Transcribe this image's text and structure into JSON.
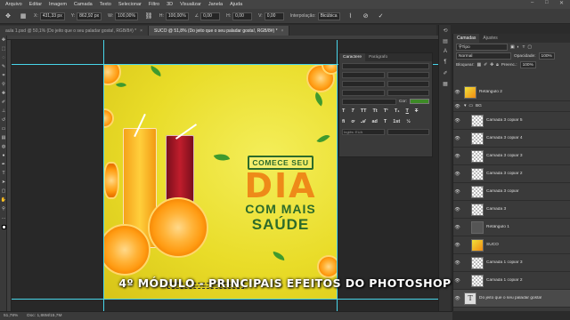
{
  "menu": [
    "Arquivo",
    "Editar",
    "Imagem",
    "Camada",
    "Texto",
    "Selecionar",
    "Filtro",
    "3D",
    "Visualizar",
    "Janela",
    "Ajuda"
  ],
  "window_controls": {
    "minimize": "–",
    "maximize": "□",
    "close": "✕"
  },
  "options": {
    "x": "431,33 px",
    "y": "862,92 px",
    "w": "100,00%",
    "h": "100,00%",
    "angle": "0,00",
    "h_skew": "0,00",
    "v_skew": "0,00",
    "interpolation_label": "Interpolação:",
    "interpolation_value": "Bicúbica"
  },
  "tabs": [
    {
      "label": "aula 1.psd @ 50,1% (Do jeito que o seu paladar gosta!, RGB/8#) *",
      "active": false
    },
    {
      "label": "SUCO @ 51,8% (Do jeito que o seu paladar gosta!, RGB/8#) *",
      "active": true
    }
  ],
  "canvas": {
    "banner": "COMECE SEU",
    "big": "DIA",
    "line2": "COM MAIS",
    "line3": "SAÚDE",
    "selection_text": "Do jeito que o seu paladar gosta!"
  },
  "char_panel": {
    "tabs": [
      "Caractere",
      "Parágrafo"
    ],
    "color_label": "Cor:",
    "language": "Inglês: EUA"
  },
  "layers_panel": {
    "tabs": [
      "Camadas",
      "Ajustes"
    ],
    "filter_kind": "Tipo",
    "blend_mode": "Normal",
    "opacity_label": "Opacidade:",
    "opacity_value": "100%",
    "lock_label": "Bloquear:",
    "fill_label": "Preenc.:",
    "fill_value": "100%",
    "layers": [
      {
        "name": "Retângulo 2",
        "kind": "img"
      },
      {
        "name": "BG",
        "kind": "group"
      },
      {
        "name": "Camada 3 copiar 5",
        "kind": "trans"
      },
      {
        "name": "Camada 3 copiar 4",
        "kind": "trans"
      },
      {
        "name": "Camada 3 copiar 3",
        "kind": "trans"
      },
      {
        "name": "Camada 3 copiar 2",
        "kind": "trans"
      },
      {
        "name": "Camada 3 copiar",
        "kind": "trans"
      },
      {
        "name": "Camada 3",
        "kind": "trans"
      },
      {
        "name": "Retângulo 1",
        "kind": "trans"
      },
      {
        "name": "SUCO",
        "kind": "img"
      },
      {
        "name": "Camada 1 copiar 3",
        "kind": "trans"
      },
      {
        "name": "Camada 1 copiar 2",
        "kind": "trans"
      },
      {
        "name": "Do jeito que o seu paladar gosta!",
        "kind": "text"
      }
    ]
  },
  "status": {
    "zoom": "51,78%",
    "doc": "Doc: 1,86M/15,7M"
  },
  "caption": "4º MÓDULO - PRINCIPAIS EFEITOS DO PHOTOSHOP",
  "colors": {
    "accent_orange": "#ee8a19",
    "accent_green": "#2d6b2a",
    "guide": "#48d6ea"
  }
}
